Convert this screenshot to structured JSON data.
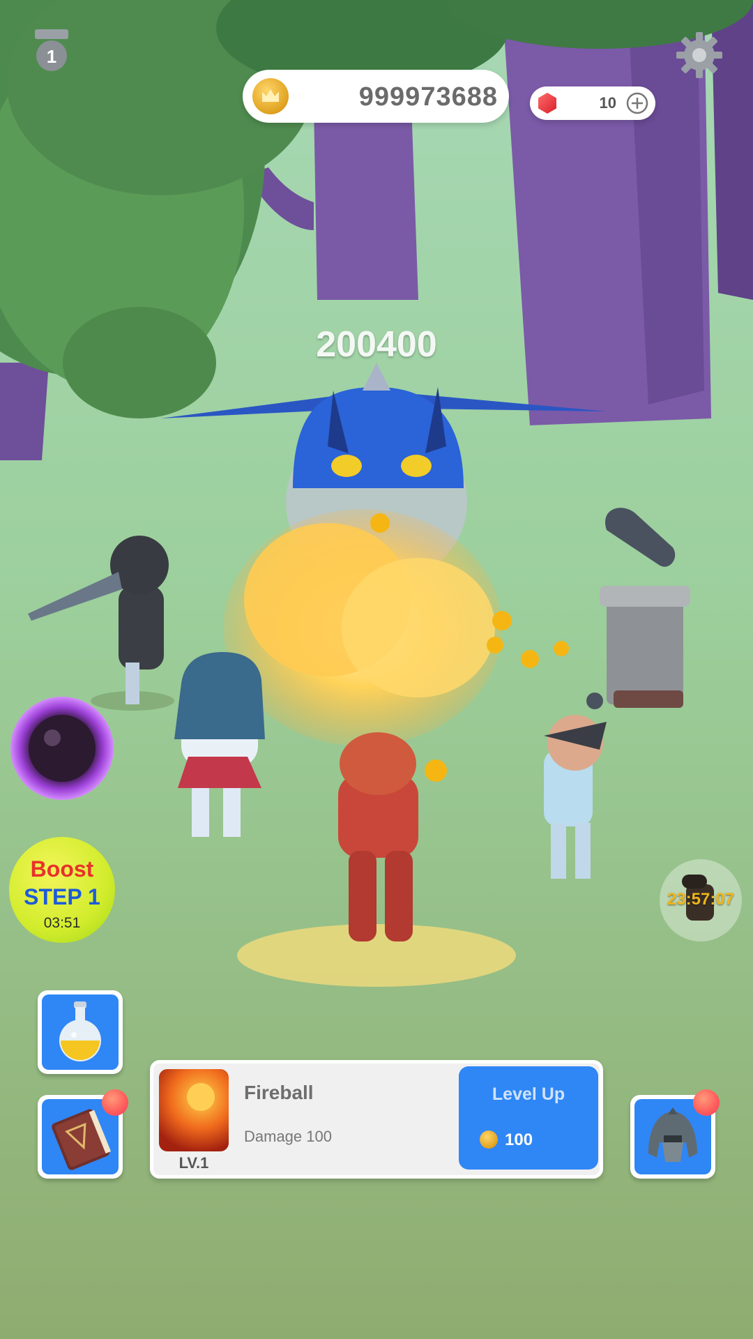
{
  "hud": {
    "rank_number": "1",
    "coins": "999973688",
    "gems": "10",
    "icons": {
      "rank": "medal-icon",
      "settings": "gear-icon",
      "coin": "crown-coin-icon",
      "gem": "red-gem-icon",
      "add": "plus-circle-icon"
    }
  },
  "boss": {
    "hp": "200400"
  },
  "boost": {
    "line1": "Boost",
    "line2": "STEP 1",
    "timer": "03:51"
  },
  "side_timer": {
    "value": "23:57:07",
    "icon": "cannon-chest-icon"
  },
  "skill_card": {
    "name": "Fireball",
    "description": "Damage 100",
    "level": "LV.1",
    "level_up_label": "Level Up",
    "cost": "100",
    "icon": "fireball-icon"
  },
  "buttons": {
    "potion": "potion-icon",
    "spellbook": "spellbook-icon",
    "helmet": "helmet-icon",
    "portal": "dark-portal-icon"
  },
  "colors": {
    "accent_blue": "#2f86f5",
    "boost_red": "#e8322a",
    "boost_blue": "#1d5bd8",
    "coin_gold": "#e0a21f",
    "notification": "#ff5a5a"
  }
}
